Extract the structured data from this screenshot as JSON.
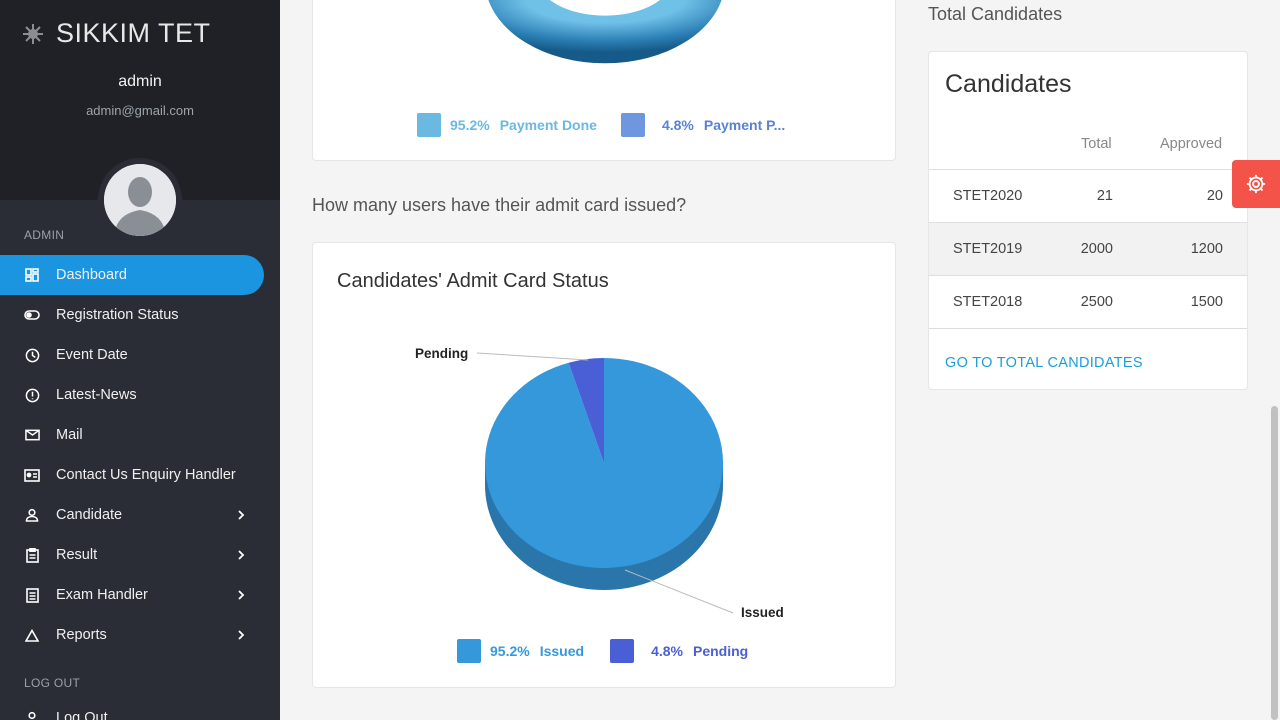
{
  "brand": {
    "title": "SIKKIM TET"
  },
  "user": {
    "name": "admin",
    "email": "admin@gmail.com"
  },
  "sidebar": {
    "section_admin": "ADMIN",
    "section_logout": "LOG OUT",
    "items": [
      {
        "label": "Dashboard",
        "icon": "dashboard-icon"
      },
      {
        "label": "Registration Status",
        "icon": "toggle-icon"
      },
      {
        "label": "Event Date",
        "icon": "clock-icon"
      },
      {
        "label": "Latest-News",
        "icon": "alert-icon"
      },
      {
        "label": "Mail",
        "icon": "mail-icon"
      },
      {
        "label": "Contact Us Enquiry Handler",
        "icon": "contact-card-icon"
      },
      {
        "label": "Candidate",
        "icon": "person-icon"
      },
      {
        "label": "Result",
        "icon": "clipboard-icon"
      },
      {
        "label": "Exam Handler",
        "icon": "list-icon"
      },
      {
        "label": "Reports",
        "icon": "triangle-icon"
      }
    ],
    "logout_item": "Log Out"
  },
  "payment_chart": {
    "legend": [
      {
        "pct": "95.2%",
        "label": "Payment Done",
        "color": "#6bb8e0"
      },
      {
        "pct": "4.8%",
        "label": "Payment P...",
        "color": "#6f97e0"
      }
    ]
  },
  "question": "How many users have their admit card issued?",
  "admit_card": {
    "title": "Candidates' Admit Card Status",
    "legend": [
      {
        "pct": "95.2%",
        "label": "Issued",
        "color": "#3498db"
      },
      {
        "pct": "4.8%",
        "label": "Pending",
        "color": "#4a5fd6"
      }
    ]
  },
  "chart_data": [
    {
      "type": "pie",
      "title": "",
      "series": [
        {
          "values": [
            95.2,
            4.8
          ]
        }
      ],
      "categories": [
        "Payment Done",
        "Payment P..."
      ]
    },
    {
      "type": "pie",
      "title": "Candidates' Admit Card Status",
      "categories": [
        "Issued",
        "Pending"
      ],
      "values": [
        95.2,
        4.8
      ],
      "colors": [
        "#3498db",
        "#4a5fd6"
      ]
    }
  ],
  "right_panel": {
    "total_label": "Total Candidates",
    "card_title": "Candidates",
    "headers": [
      "Total",
      "Approved"
    ],
    "rows": [
      {
        "name": "STET2020",
        "total": "21",
        "approved": "20"
      },
      {
        "name": "STET2019",
        "total": "2000",
        "approved": "1200"
      },
      {
        "name": "STET2018",
        "total": "2500",
        "approved": "1500"
      }
    ],
    "link": "GO TO TOTAL CANDIDATES"
  }
}
